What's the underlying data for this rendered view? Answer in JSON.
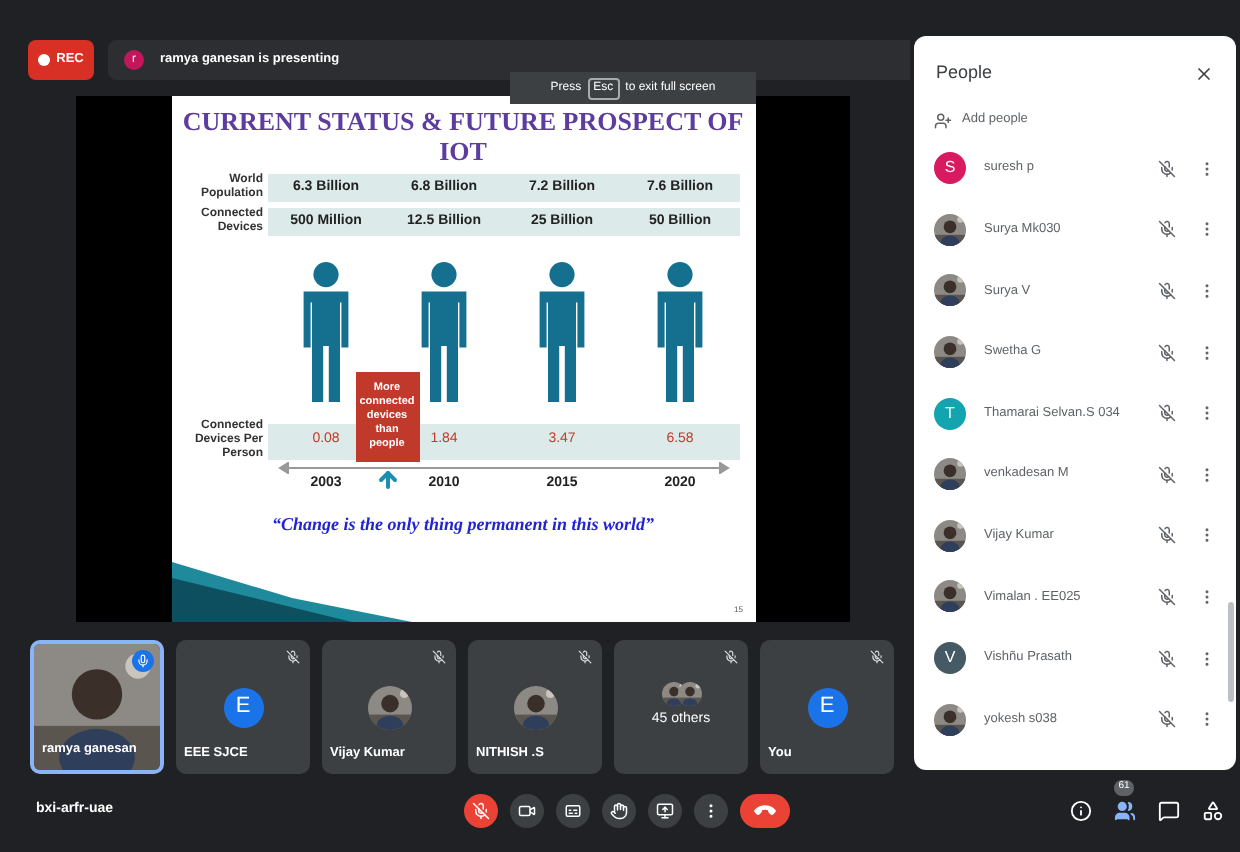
{
  "top_bar": {
    "rec_label": "REC",
    "presenter": {
      "initial": "r",
      "color": "#c2185b",
      "text": "ramya ganesan is presenting"
    }
  },
  "fullscreen_notice": {
    "before": "Press",
    "key": "Esc",
    "after": "to exit full screen"
  },
  "slide": {
    "title_lines": [
      "CURRENT STATUS & FUTURE PROSPECT OF",
      "IOT"
    ],
    "rows": [
      {
        "label": "World Population",
        "values": [
          "6.3 Billion",
          "6.8 Billion",
          "7.2 Billion",
          "7.6 Billion"
        ]
      },
      {
        "label": "Connected Devices",
        "values": [
          "500 Million",
          "12.5 Billion",
          "25 Billion",
          "50 Billion"
        ]
      }
    ],
    "per_person": {
      "label": "Connected Devices Per Person",
      "values": [
        "0.08",
        "1.84",
        "3.47",
        "6.58"
      ]
    },
    "callout": "More connected devices than people",
    "years": [
      "2003",
      "2010",
      "2015",
      "2020"
    ],
    "quote": "“Change is the only thing permanent in this world”",
    "page": "15"
  },
  "tiles": [
    {
      "name": "ramya ganesan",
      "kind": "video",
      "speaking": true
    },
    {
      "name": "EEE SJCE",
      "kind": "letter",
      "letter": "E",
      "color": "#1a73e8",
      "speaking": false
    },
    {
      "name": "Vijay Kumar",
      "speaking": false
    },
    {
      "name": "NITHISH .S",
      "speaking": false
    },
    {
      "name": "45 others",
      "kind": "others",
      "speaking": false
    },
    {
      "name": "You",
      "kind": "letter",
      "letter": "E",
      "color": "#1a73e8",
      "speaking": false
    }
  ],
  "meeting_code": "bxi-arfr-uae",
  "controls": [
    {
      "kind": "mic",
      "muted": true
    },
    {
      "kind": "camera"
    },
    {
      "kind": "captions"
    },
    {
      "kind": "hand"
    },
    {
      "kind": "present"
    },
    {
      "kind": "more"
    },
    {
      "kind": "leave"
    }
  ],
  "side_buttons": [
    {
      "kind": "info",
      "selected": false
    },
    {
      "kind": "people",
      "selected": true,
      "badge": "61"
    },
    {
      "kind": "chat",
      "selected": false
    },
    {
      "kind": "activities",
      "selected": false
    }
  ],
  "people_panel": {
    "title": "People",
    "add_label": "Add people",
    "participants": [
      {
        "name": "suresh p",
        "kind": "letter",
        "letter": "S",
        "color": "#d81b60",
        "muted": true
      },
      {
        "name": "Surya Mk030",
        "muted": true
      },
      {
        "name": "Surya V",
        "muted": true
      },
      {
        "name": "Swetha G",
        "muted": true
      },
      {
        "name": "Thamarai Selvan.S 034",
        "kind": "letter",
        "letter": "T",
        "color": "#12a4af",
        "muted": true
      },
      {
        "name": "venkadesan M",
        "muted": true
      },
      {
        "name": "Vijay Kumar",
        "muted": true
      },
      {
        "name": "Vimalan . EE025",
        "muted": true
      },
      {
        "name": "Vishñu Prasath",
        "kind": "letter",
        "letter": "V",
        "color": "#455a64",
        "muted": true
      },
      {
        "name": "yokesh s038",
        "muted": true
      }
    ]
  }
}
